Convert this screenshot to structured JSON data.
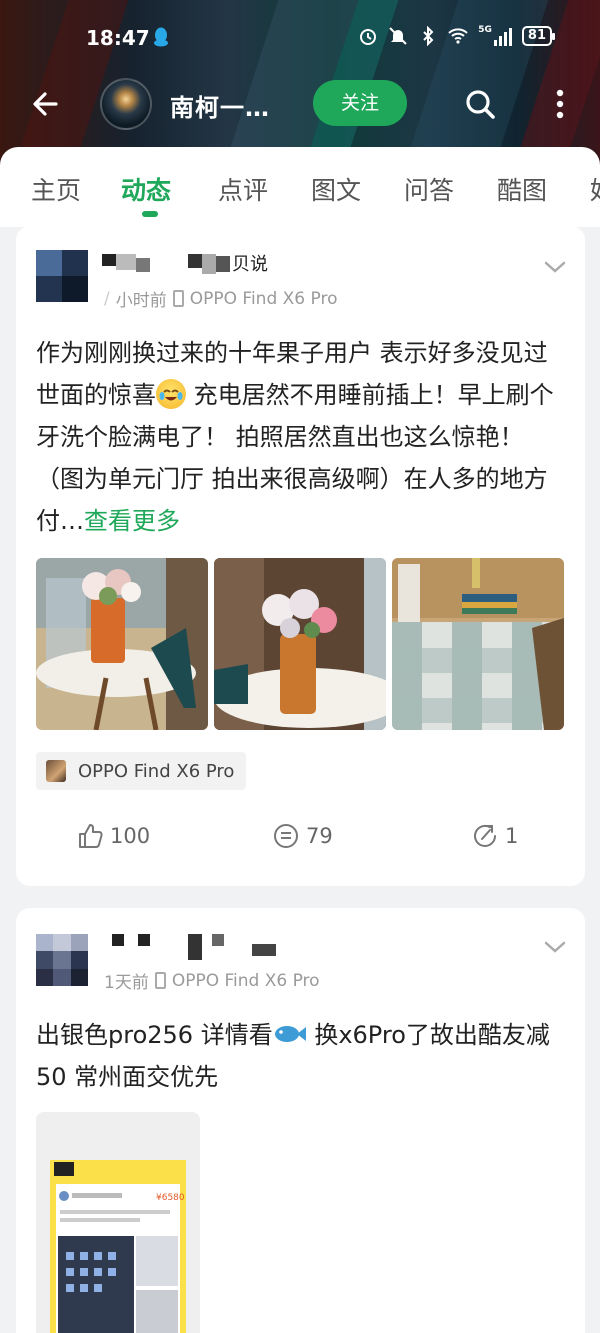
{
  "status_bar": {
    "time": "18:47",
    "battery": "81",
    "network": "5G"
  },
  "header": {
    "title": "南柯一…",
    "follow_label": "关注"
  },
  "tabs": [
    {
      "label": "主页",
      "active": false
    },
    {
      "label": "动态",
      "active": true
    },
    {
      "label": "点评",
      "active": false
    },
    {
      "label": "图文",
      "active": false
    },
    {
      "label": "问答",
      "active": false
    },
    {
      "label": "酷图",
      "active": false
    },
    {
      "label": "好",
      "active": false
    }
  ],
  "posts": [
    {
      "author_visible": "贝说",
      "time": "小时前",
      "device": "OPPO Find X6 Pro",
      "text": "作为刚刚换过来的十年果子用户 表示好多没见过世面的惊喜",
      "text_after_emoji": " 充电居然不用睡前插上！早上刷个牙洗个脸满电了！ 拍照居然直出也这么惊艳！ （图为单元门厅 拍出来很高级啊）在人多的地方付…",
      "see_more": "查看更多",
      "device_tag": "OPPO Find X6 Pro",
      "likes": "100",
      "comments": "79",
      "shares": "1"
    },
    {
      "time": "1天前",
      "device": "OPPO Find X6 Pro",
      "text": "出银色pro256 详情看",
      "text_after_emoji": " 换x6Pro了故出酷友减50 常州面交优先",
      "image_price": "¥6580"
    }
  ],
  "colors": {
    "accent": "#1fa85a",
    "background": "#f1f2f4"
  }
}
